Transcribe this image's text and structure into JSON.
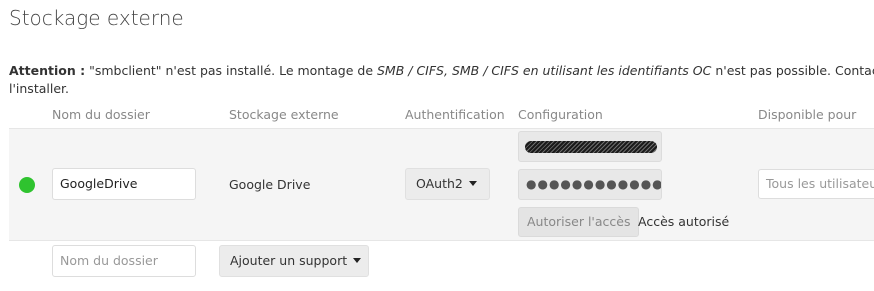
{
  "page": {
    "title": "Stockage externe"
  },
  "warning": {
    "bold": "Attention :",
    "text1": " \"smbclient\" n'est pas installé. Le montage de ",
    "italic": "SMB / CIFS, SMB / CIFS en utilisant les identifiants OC",
    "text2": " n'est pas possible. Contactez votre a",
    "line2": "l'installer."
  },
  "table": {
    "headers": {
      "folder": "Nom du dossier",
      "storage": "Stockage externe",
      "auth": "Authentification",
      "config": "Configuration",
      "available": "Disponible pour"
    },
    "row": {
      "status_color": "#2fc32f",
      "folder_name": "GoogleDrive",
      "storage": "Google Drive",
      "auth": "OAuth2",
      "config_secret_mask": "●●●●●●●●●●●●●●●●●",
      "authorize_button": "Autoriser l'accès",
      "access_status": "Accès autorisé",
      "available_placeholder": "Tous les utilisateurs"
    },
    "new_row": {
      "folder_placeholder": "Nom du dossier",
      "add_button": "Ajouter un support"
    }
  }
}
